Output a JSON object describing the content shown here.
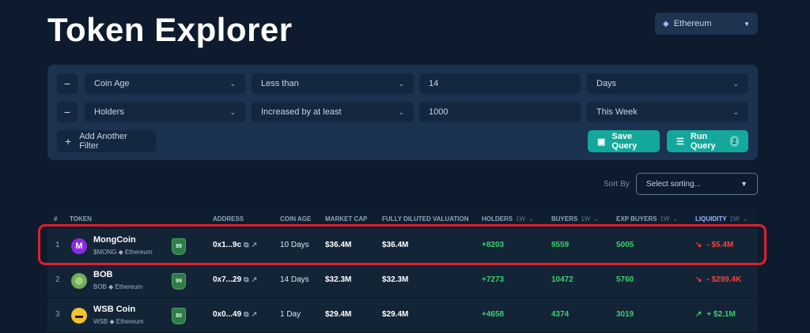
{
  "page": {
    "title": "Token Explorer"
  },
  "chain_select": {
    "value": "Ethereum",
    "icon": "ethereum-icon"
  },
  "filters": [
    {
      "field": "Coin Age",
      "operator": "Less than",
      "value": "14",
      "unit": "Days"
    },
    {
      "field": "Holders",
      "operator": "Increased by at least",
      "value": "1000",
      "unit": "This Week"
    }
  ],
  "actions": {
    "add_filter": "Add Another Filter",
    "save_query": "Save Query",
    "run_query": "Run Query",
    "run_query_badge": "2"
  },
  "sort": {
    "label": "Sort By",
    "placeholder": "Select sorting..."
  },
  "table": {
    "headers": {
      "rank": "#",
      "token": "TOKEN",
      "address": "ADDRESS",
      "coin_age": "COIN AGE",
      "market_cap": "MARKET CAP",
      "fdv": "FULLY DILUTED VALUATION",
      "holders": "HOLDERS",
      "buyers": "BUYERS",
      "exp_buyers": "EXP BUYERS",
      "liquidity": "LIQUIDITY",
      "timeframe": "1W"
    },
    "rows": [
      {
        "rank": "1",
        "name": "MongCoin",
        "symbol": "$MONG",
        "chain": "Ethereum",
        "score": "99",
        "address": "0x1...9c",
        "coin_age": "10 Days",
        "market_cap": "$36.4M",
        "fdv": "$36.4M",
        "holders": "+8203",
        "buyers": "9559",
        "exp_buyers": "5005",
        "liquidity": "- $5.4M",
        "avatar_glyph": "M",
        "avatar_color": "#8a2be2",
        "trend": "down"
      },
      {
        "rank": "2",
        "name": "BOB",
        "symbol": "BOB",
        "chain": "Ethereum",
        "score": "99",
        "address": "0x7...29",
        "coin_age": "14 Days",
        "market_cap": "$32.3M",
        "fdv": "$32.3M",
        "holders": "+7273",
        "buyers": "10472",
        "exp_buyers": "5760",
        "liquidity": "- $299.4K",
        "avatar_glyph": "",
        "avatar_color": "#6fae5a",
        "trend": "down"
      },
      {
        "rank": "3",
        "name": "WSB Coin",
        "symbol": "WSB",
        "chain": "Ethereum",
        "score": "80",
        "address": "0x0...49",
        "coin_age": "1 Day",
        "market_cap": "$29.4M",
        "fdv": "$29.4M",
        "holders": "+4658",
        "buyers": "4374",
        "exp_buyers": "3019",
        "liquidity": "+ $2.1M",
        "avatar_glyph": "",
        "avatar_color": "#f2c230",
        "trend": "up"
      }
    ]
  },
  "colors": {
    "accent": "#13a89b",
    "positive": "#37d36b",
    "negative": "#f0443a",
    "highlight": "#e0202b"
  }
}
